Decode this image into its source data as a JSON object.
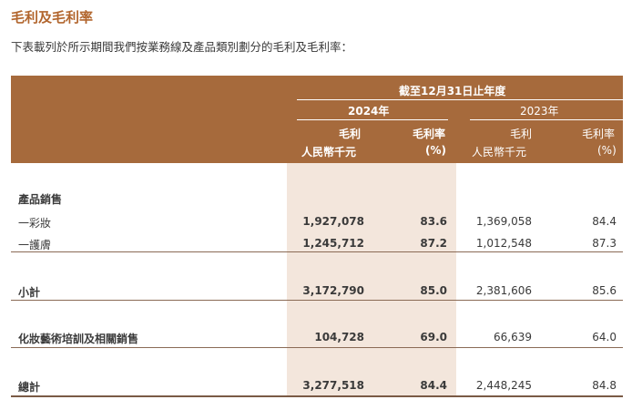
{
  "title": "毛利及毛利率",
  "intro": "下表載列於所示期間我們按業務線及產品類別劃分的毛利及毛利率：",
  "header": {
    "period": "截至12月31日止年度",
    "year_2024": "2024年",
    "year_2023": "2023年",
    "col_gross_profit": "毛利",
    "col_margin": "毛利率",
    "unit_rmb": "人民幣千元",
    "unit_pct": "(%)"
  },
  "rows": {
    "product_sales": {
      "label": "產品銷售"
    },
    "makeup": {
      "label": "一彩妝",
      "gp_2024": "1,927,078",
      "gm_2024": "83.6",
      "gp_2023": "1,369,058",
      "gm_2023": "84.4"
    },
    "skincare": {
      "label": "一護膚",
      "gp_2024": "1,245,712",
      "gm_2024": "87.2",
      "gp_2023": "1,012,548",
      "gm_2023": "87.3"
    },
    "subtotal": {
      "label": "小計",
      "gp_2024": "3,172,790",
      "gm_2024": "85.0",
      "gp_2023": "2,381,606",
      "gm_2023": "85.6"
    },
    "training": {
      "label": "化妝藝術培訓及相關銷售",
      "gp_2024": "104,728",
      "gm_2024": "69.0",
      "gp_2023": "66,639",
      "gm_2023": "64.0"
    },
    "total": {
      "label": "總計",
      "gp_2024": "3,277,518",
      "gm_2024": "84.4",
      "gp_2023": "2,448,245",
      "gm_2023": "84.8"
    }
  },
  "colors": {
    "accent": "#b2662e",
    "header_bg": "#a66a3c",
    "highlight_bg": "#f3e6dc"
  }
}
